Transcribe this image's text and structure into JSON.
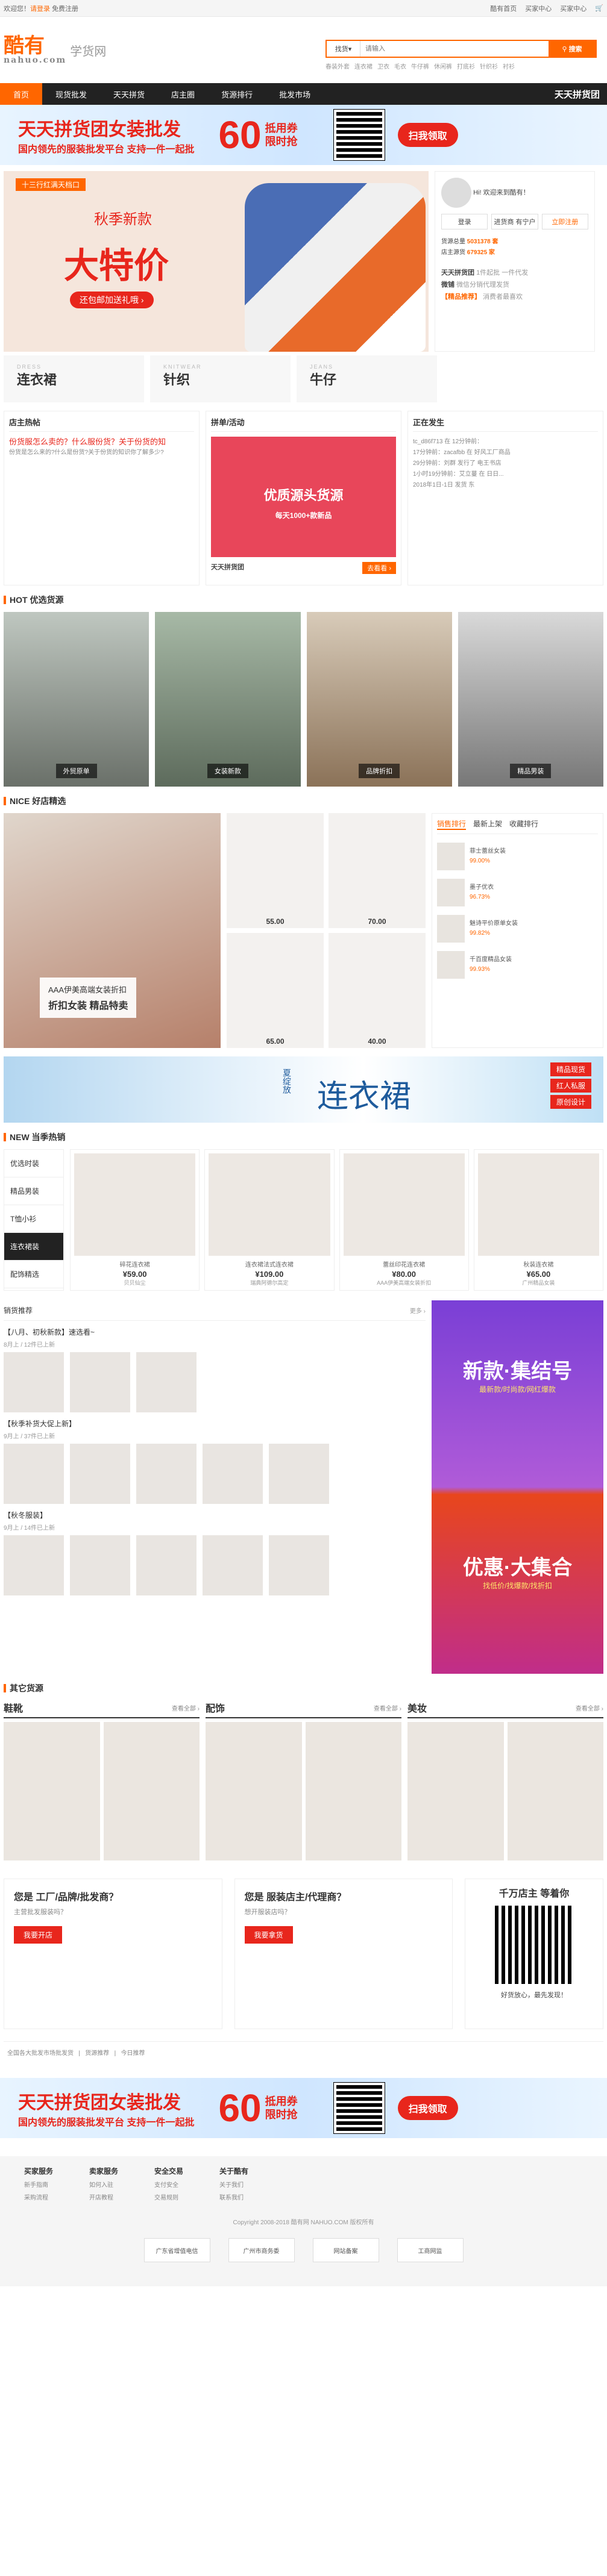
{
  "topbar": {
    "welcome": "欢迎您！",
    "login": "请登录",
    "register": "免费注册",
    "home": "酷有首页",
    "buyer": "买家中心",
    "seller": "买家中心"
  },
  "logo": {
    "text": "酷有",
    "sub": "nahuo.com",
    "slogan": "学货网"
  },
  "search": {
    "select": "找货",
    "placeholder": "请输入",
    "button": "搜索",
    "hot": [
      "春装外套",
      "连衣裙",
      "卫衣",
      "毛衣",
      "牛仔裤",
      "休闲裤",
      "打底衫",
      "针织衫",
      "衬衫",
      "毛衣"
    ]
  },
  "nav": {
    "items": [
      "首页",
      "现货批发",
      "天天拼货",
      "店主圈",
      "货源排行",
      "批发市场"
    ],
    "right": "天天拼货团"
  },
  "banner": {
    "title": "天天拼货团女装批发",
    "sub": "国内领先的服装批发平台 支持一件一起批",
    "amount": "60",
    "unit": "¥",
    "c1": "抵用券",
    "c2": "限时抢",
    "scan": "扫我领取"
  },
  "hero": {
    "tag": "十三行红满天档口",
    "line1": "秋季新款",
    "line2": "大特价",
    "btn": "还包邮加送礼哦 ›",
    "brand": "ccardion"
  },
  "user": {
    "hello": "Hi!",
    "welcome": "欢迎来到酷有！",
    "login": "登录",
    "join": "进货商 有宁户",
    "go": "立即注册",
    "stat1": "货源总量",
    "stat1v": "5031378 套",
    "stat2": "店主源货",
    "stat2v": "679325 家",
    "r1": "天天拼货团",
    "r1d": "1件起批 一件代发",
    "r2": "微铺",
    "r2d": "微信分销代理发货",
    "r3": "【精品推荐】",
    "r3d": "消费者最喜欢"
  },
  "cats": [
    {
      "en": "DRESS",
      "zh": "连衣裙"
    },
    {
      "en": "KNITWEAR",
      "zh": "针织"
    },
    {
      "en": "JEANS",
      "zh": "牛仔"
    }
  ],
  "col1": {
    "title": "店主热帖",
    "hot": "份货服怎么卖的？什么服份货？关于份货的知",
    "text": "份货是怎么来的?什么是份货?关于份货的知识你了解多少?"
  },
  "col2": {
    "title": "拼单/活动",
    "ad1": "优质源头货源",
    "ad2": "每天1000+款新品",
    "brand": "天天拼货团",
    "go": "去看看 ›"
  },
  "col3": {
    "title": "正在发生",
    "items": [
      "tc_d86f713 在 12分钟前：",
      "17分钟前：zacafbb 在 好风工厂商品",
      "29分钟前：刘群 发行了 电王书店",
      "1小时19分钟前：艾立蔓 在 日日...",
      "2018年1日-1日 发货 东"
    ]
  },
  "hot": {
    "title": "HOT 优选货源",
    "tiles": [
      "外贸原单",
      "女装新款",
      "品牌折扣",
      "精品男装"
    ]
  },
  "nice": {
    "title": "NICE 好店精选",
    "card1": "AAA伊美高端女装折扣",
    "card2": "折扣女装 精品特卖",
    "prices": [
      "55.00",
      "70.00",
      "65.00",
      "40.00"
    ],
    "tabs": [
      "销售排行",
      "最新上架",
      "收藏排行"
    ],
    "rank": [
      {
        "n": "菲士蕾丝女装",
        "v": "99.00%"
      },
      {
        "n": "墨子优衣",
        "v": "96.73%"
      },
      {
        "n": "魅诗平价原单女装",
        "v": "99.82%"
      },
      {
        "n": "千百度精品女装",
        "v": "99.93%"
      }
    ]
  },
  "dressbanner": {
    "title": "连衣裙",
    "tag1": "夏绽放",
    "tags": [
      "精品现货",
      "红人私服",
      "原创设计"
    ]
  },
  "new": {
    "title": "NEW 当季热销",
    "list": [
      "优选时装",
      "精品男装",
      "T恤小衫",
      "连衣裙装",
      "配饰精选"
    ],
    "prods": [
      {
        "n": "碎花连衣裙",
        "p": "¥59.00",
        "s": "贝贝仙尘"
      },
      {
        "n": "连衣裙法式连衣裙",
        "p": "¥109.00",
        "s": "瑞典阿德尔高定"
      },
      {
        "n": "蕾丝印花连衣裙",
        "p": "¥80.00",
        "s": "AAA伊美高端女装折扣"
      },
      {
        "n": "秋装连衣裙",
        "p": "¥65.00",
        "s": "广州精品女装"
      }
    ]
  },
  "sale": {
    "title": "销货推荐",
    "more": "更多 ›",
    "g1": "【八月、初秋新款】速选看~",
    "g1s": "8月上 / 12件已上新",
    "g2": "【秋季补货大促上新】",
    "g2s": "9月上 / 37件已上新",
    "g3": "【秋冬服装】",
    "g3s": "9月上 / 14件已上新",
    "side1": "新款·集结号",
    "side1b": "最新款/时尚款/网红爆款",
    "side2": "优惠·大集合",
    "side2b": "找低价/找爆款/找折扣"
  },
  "other": {
    "title": "其它货源",
    "cats": [
      "鞋靴",
      "配饰",
      "美妆"
    ],
    "more": "查看全部 ›"
  },
  "join": {
    "c1t": "您是 工厂/品牌/批发商？",
    "c1p": "主营批发服装吗？",
    "c1b": "我要开店",
    "c2t": "您是 服装店主/代理商？",
    "c2p": "想开服装店吗？",
    "c2b": "我要拿货",
    "qr": "千万店主 等着你",
    "qrs": "好货放心，最先发现！"
  },
  "footlinks": [
    "全国各大批发市场批发货",
    "货源推荐",
    "今日推荐"
  ],
  "foot": [
    {
      "h": "买家服务",
      "a": "新手指南",
      "b": "采购流程"
    },
    {
      "h": "卖家服务",
      "a": "如何入驻",
      "b": "开店教程"
    },
    {
      "h": "安全交易",
      "a": "支付安全",
      "b": "交易规则"
    },
    {
      "h": "关于酷有",
      "a": "关于我们",
      "b": "联系我们"
    }
  ],
  "copy": "Copyright 2008-2018 酷有网 NAHUO.COM 版权所有",
  "badges": [
    "广东省增值电信",
    "广州市商务委",
    "网站备案",
    "工商网监"
  ],
  "colors": {
    "brand": "#ff6600",
    "red": "#e8261c",
    "nav": "#222222"
  }
}
